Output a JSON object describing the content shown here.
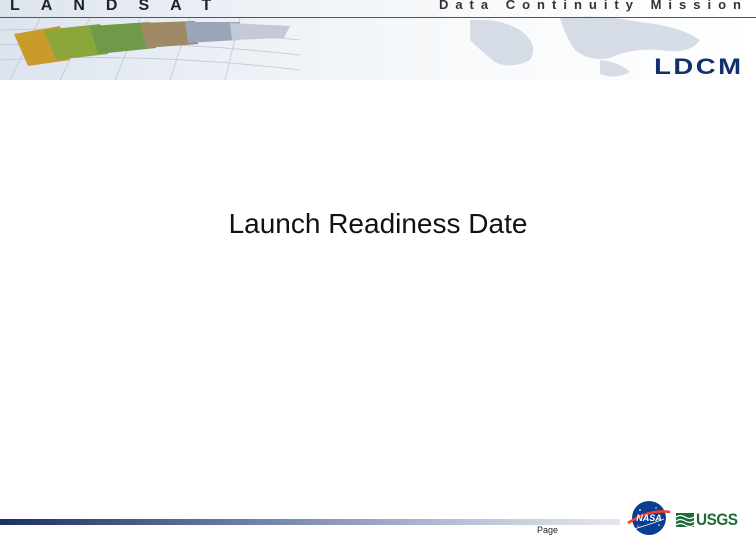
{
  "header": {
    "left_title": "LANDSAT",
    "right_title": "Data Continuity Mission",
    "logo_text": "LDCM"
  },
  "slide": {
    "title": "Launch Readiness Date"
  },
  "footer": {
    "page_label": "Page",
    "logos": [
      "nasa-logo",
      "usgs-logo"
    ],
    "usgs_text": "USGS"
  },
  "colors": {
    "header_bg": "#dde4ee",
    "logo_blue": "#12306b",
    "footer_bar": "#1c2f66",
    "usgs_green": "#1c6b3a"
  }
}
